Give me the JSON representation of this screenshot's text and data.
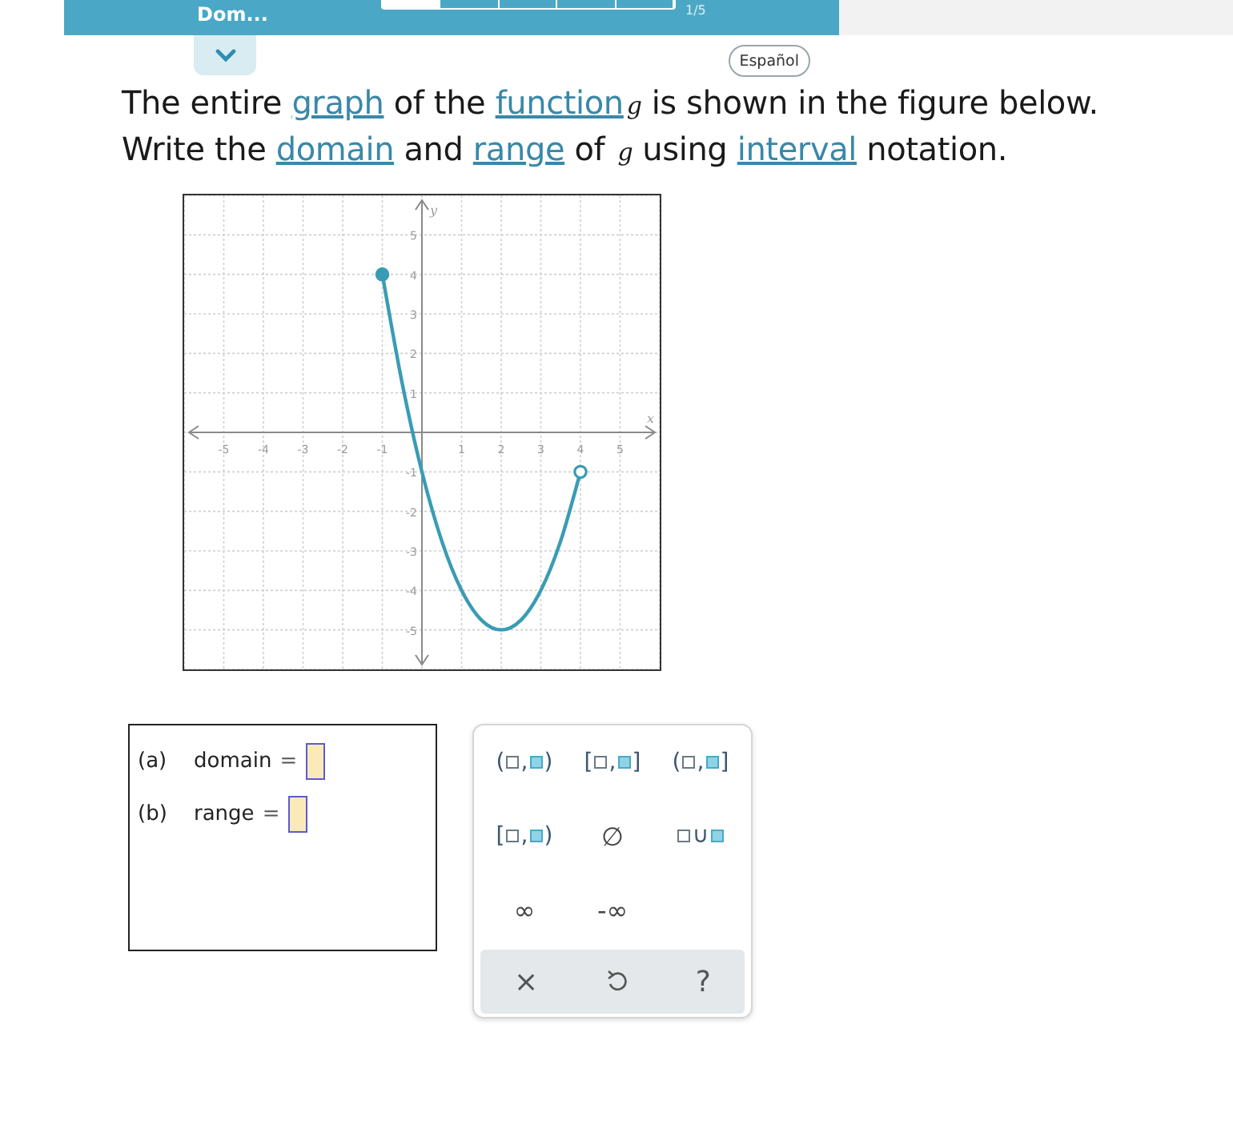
{
  "header": {
    "title": "Dom...",
    "progress": {
      "level": 0.2
    },
    "counter": "1/5"
  },
  "language_button": "Español",
  "question": {
    "lines": [
      [
        {
          "kind": "text",
          "text": "The entire "
        },
        {
          "kind": "link",
          "text": "graph"
        },
        {
          "kind": "text",
          "text": " of the "
        },
        {
          "kind": "link",
          "text": "function"
        },
        {
          "kind": "var",
          "text": "g"
        },
        {
          "kind": "text",
          "text": "is shown in the figure below."
        }
      ],
      [
        {
          "kind": "text",
          "text": "Write the "
        },
        {
          "kind": "link",
          "text": "domain"
        },
        {
          "kind": "text",
          "text": " and "
        },
        {
          "kind": "link",
          "text": "range"
        },
        {
          "kind": "text",
          "text": " of "
        },
        {
          "kind": "var",
          "text": "g"
        },
        {
          "kind": "text",
          "text": "using "
        },
        {
          "kind": "link",
          "text": "interval"
        },
        {
          "kind": "text",
          "text": " notation."
        }
      ]
    ]
  },
  "graph": {
    "start_closed": true,
    "end_closed": false,
    "chart_data": {
      "type": "line",
      "grid": true,
      "xlabel": "x",
      "ylabel": "y",
      "x": [
        -1,
        -0.5,
        0,
        0.5,
        1,
        1.5,
        2,
        2.5,
        3,
        3.5,
        4
      ],
      "series": [
        {
          "color": "#3a9cb4",
          "values": [
            4,
            1.25,
            -1,
            -2.75,
            -4,
            -4.75,
            -5,
            -4.75,
            -4,
            -2.75,
            -1
          ]
        }
      ],
      "xlim": [
        -6,
        6
      ],
      "ylim": [
        -6,
        6
      ],
      "xticks": [
        -5,
        -4,
        -3,
        -2,
        -1,
        1,
        2,
        3,
        4,
        5
      ],
      "yticks": [
        -5,
        -4,
        -3,
        -2,
        -1,
        1,
        2,
        3,
        4,
        5
      ]
    }
  },
  "answers": [
    {
      "label": "(a)",
      "name": "domain",
      "sign": "="
    },
    {
      "label": "(b)",
      "name": "range",
      "sign": "="
    }
  ],
  "keypad": {
    "keys": [
      {
        "kind": "interval",
        "open": "(",
        "sep": ",",
        "close": ")"
      },
      {
        "kind": "interval",
        "open": "[",
        "sep": ",",
        "close": "]"
      },
      {
        "kind": "interval",
        "open": "(",
        "sep": ",",
        "close": "]"
      },
      {
        "kind": "interval",
        "open": "[",
        "sep": ",",
        "close": ")"
      },
      {
        "kind": "symbol",
        "text": "∅"
      },
      {
        "kind": "union",
        "text": "∪"
      },
      {
        "kind": "symbol",
        "text": "∞"
      },
      {
        "kind": "symbol",
        "text": "-∞"
      }
    ],
    "actions": [
      {
        "kind": "clear",
        "text": "×"
      },
      {
        "kind": "undo"
      },
      {
        "kind": "help",
        "text": "?"
      }
    ]
  }
}
